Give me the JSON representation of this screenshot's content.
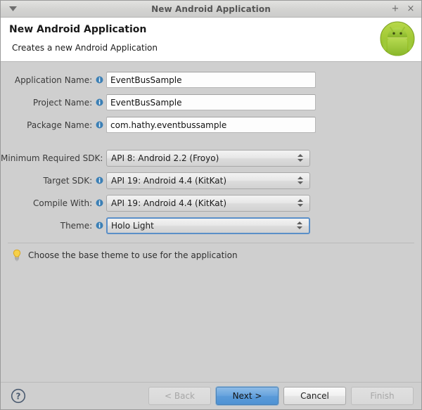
{
  "window": {
    "title": "New Android Application",
    "menu_icon": "window-menu-caret-icon",
    "maximize_label": "+",
    "close_label": "×"
  },
  "header": {
    "title": "New Android Application",
    "subtitle": "Creates a new Android Application",
    "logo_icon": "android-robot-icon"
  },
  "form": {
    "info_icon": "info-icon",
    "text_fields": [
      {
        "label": "Application Name:",
        "value": "EventBusSample",
        "placeholder": ""
      },
      {
        "label": "Project Name:",
        "value": "EventBusSample",
        "placeholder": ""
      },
      {
        "label": "Package Name:",
        "value": "com.hathy.eventbussample",
        "placeholder": ""
      }
    ],
    "combos": [
      {
        "label": "Minimum Required SDK:",
        "value": "API 8: Android 2.2 (Froyo)",
        "focused": false
      },
      {
        "label": "Target SDK:",
        "value": "API 19: Android 4.4 (KitKat)",
        "focused": false
      },
      {
        "label": "Compile With:",
        "value": "API 19: Android 4.4 (KitKat)",
        "focused": false
      },
      {
        "label": "Theme:",
        "value": "Holo Light",
        "focused": true
      }
    ]
  },
  "hint": {
    "icon": "lightbulb-icon",
    "text": "Choose the base theme to use for the application"
  },
  "footer": {
    "help_icon": "help-question-icon",
    "buttons": [
      {
        "label": "< Back",
        "state": "disabled"
      },
      {
        "label": "Next >",
        "state": "primary"
      },
      {
        "label": "Cancel",
        "state": "normal"
      },
      {
        "label": "Finish",
        "state": "disabled"
      }
    ]
  },
  "colors": {
    "dialog_bg": "#cfcfcf",
    "header_bg": "#ffffff",
    "accent_blue": "#5a9bd9",
    "focus_border": "#5a8fc8",
    "android_green": "#a4c639",
    "info_blue": "#3b7fb5",
    "bulb_yellow": "#f4c430"
  }
}
